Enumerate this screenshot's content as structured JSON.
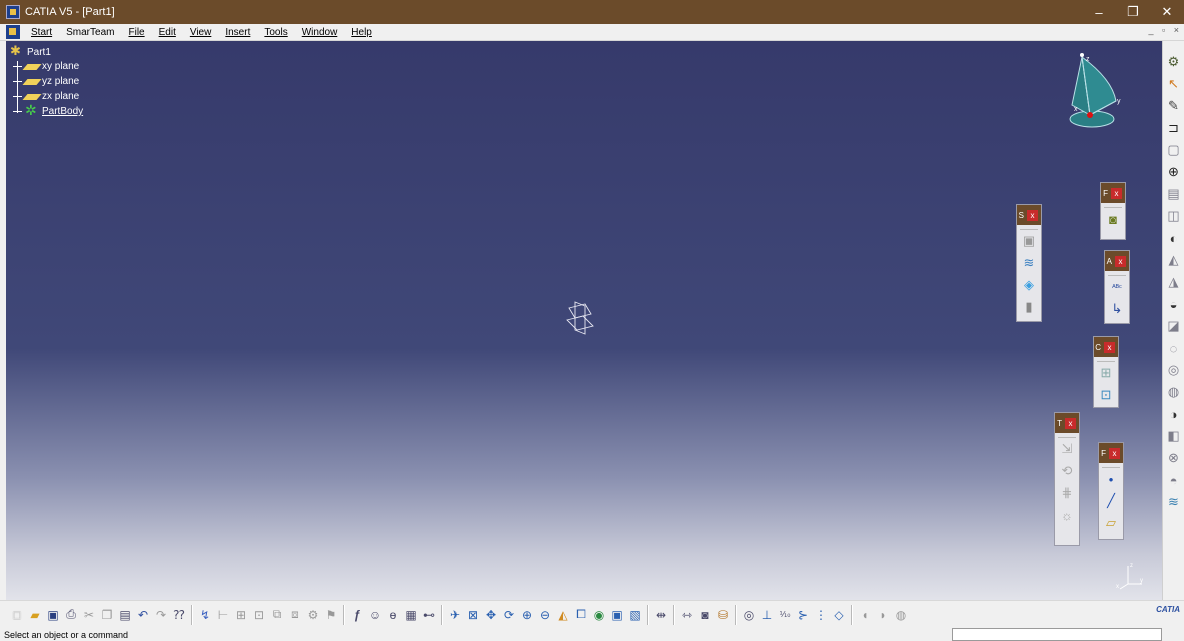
{
  "window": {
    "title": "CATIA V5 - [Part1]",
    "controls": {
      "minimize": "–",
      "restore": "❐",
      "close": "✕"
    }
  },
  "menu": {
    "items": [
      "Start",
      "SmarTeam",
      "File",
      "Edit",
      "View",
      "Insert",
      "Tools",
      "Window",
      "Help"
    ],
    "mdi_controls": "_ ▫ ×"
  },
  "tree": {
    "root": "Part1",
    "nodes": [
      "xy plane",
      "yz plane",
      "zx plane",
      "PartBody"
    ]
  },
  "compass": {
    "axis_x": "x",
    "axis_y": "y",
    "axis_z": "z"
  },
  "mini_axis": {
    "x": "x",
    "y": "y",
    "z": "z"
  },
  "float_toolbars": [
    {
      "letter": "S",
      "close": "x"
    },
    {
      "letter": "F",
      "close": "x"
    },
    {
      "letter": "A",
      "close": "x"
    },
    {
      "letter": "C",
      "close": "x"
    },
    {
      "letter": "T",
      "close": "x"
    },
    {
      "letter": "F",
      "close": "x"
    }
  ],
  "bottom": {
    "logo": "CATIA"
  },
  "status": {
    "message": "Select an object or a command"
  },
  "colors": {
    "titlebar": "#6b4b2a",
    "viewport_top": "#363a6b",
    "viewport_bottom": "#e2e3ea",
    "tree_text": "#ffffff"
  }
}
